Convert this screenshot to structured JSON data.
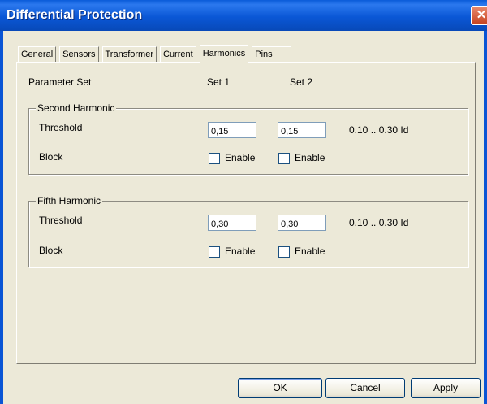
{
  "window": {
    "title": "Differential Protection",
    "close_glyph": "✕"
  },
  "tabs": [
    {
      "label": "General"
    },
    {
      "label": "Sensors"
    },
    {
      "label": "Transformer"
    },
    {
      "label": "Current"
    },
    {
      "label": "Harmonics",
      "active": true
    },
    {
      "label": "Pins"
    }
  ],
  "header": {
    "parameter_set": "Parameter Set",
    "set1": "Set 1",
    "set2": "Set 2"
  },
  "second_harmonic": {
    "legend": "Second Harmonic",
    "threshold_label": "Threshold",
    "threshold_set1": "0,15",
    "threshold_set2": "0,15",
    "range": "0.10 .. 0.30 Id",
    "block_label": "Block",
    "enable_set1_label": "Enable",
    "enable_set1_checked": false,
    "enable_set2_label": "Enable",
    "enable_set2_checked": false
  },
  "fifth_harmonic": {
    "legend": "Fifth Harmonic",
    "threshold_label": "Threshold",
    "threshold_set1": "0,30",
    "threshold_set2": "0,30",
    "range": "0.10 .. 0.30 Id",
    "block_label": "Block",
    "enable_set1_label": "Enable",
    "enable_set1_checked": false,
    "enable_set2_label": "Enable",
    "enable_set2_checked": false
  },
  "buttons": {
    "ok": "OK",
    "cancel": "Cancel",
    "apply": "Apply"
  },
  "colors": {
    "titlebar": "#0a57d6",
    "dialog_bg": "#ece9d8",
    "close": "#c6411e"
  }
}
